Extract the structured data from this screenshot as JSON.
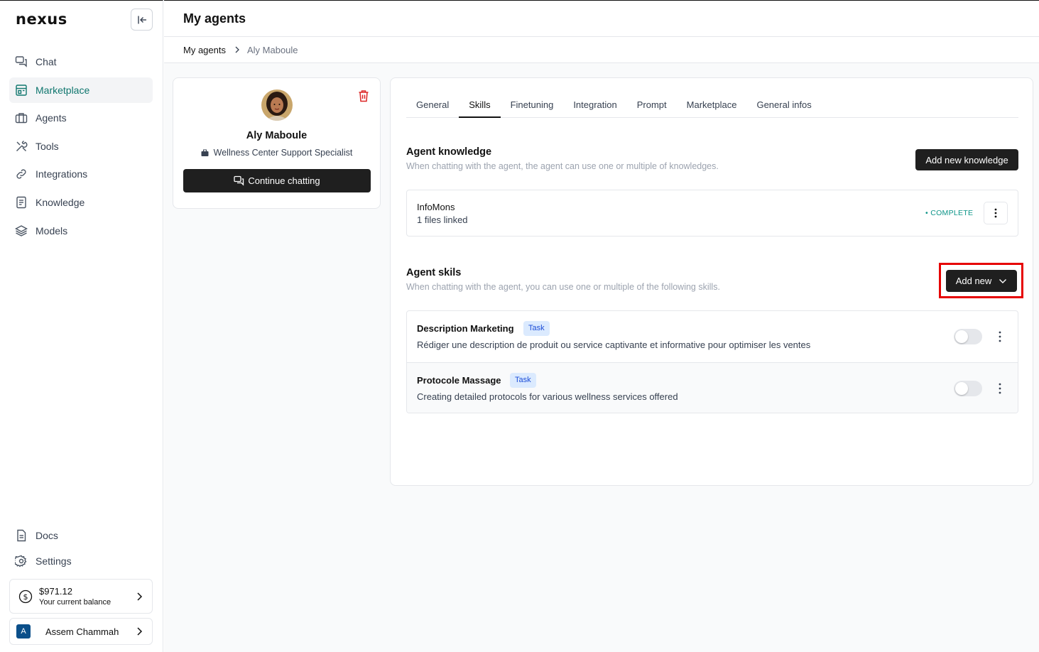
{
  "app": {
    "logo": "nexus"
  },
  "sidebar": {
    "items": [
      {
        "label": "Chat",
        "icon": "chat-icon",
        "active": false
      },
      {
        "label": "Marketplace",
        "icon": "store-icon",
        "active": true
      },
      {
        "label": "Agents",
        "icon": "briefcase-icon",
        "active": false
      },
      {
        "label": "Tools",
        "icon": "tools-icon",
        "active": false
      },
      {
        "label": "Integrations",
        "icon": "link-icon",
        "active": false
      },
      {
        "label": "Knowledge",
        "icon": "document-icon",
        "active": false
      },
      {
        "label": "Models",
        "icon": "layers-icon",
        "active": false
      }
    ],
    "bottom_items": [
      {
        "label": "Docs",
        "icon": "docs-icon"
      },
      {
        "label": "Settings",
        "icon": "gear-icon"
      }
    ],
    "balance": {
      "amount": "$971.12",
      "caption": "Your current balance"
    },
    "user": {
      "initial": "A",
      "name": "Assem Chammah"
    }
  },
  "header": {
    "title": "My agents"
  },
  "breadcrumb": [
    "My agents",
    "Aly Maboule"
  ],
  "profile": {
    "name": "Aly Maboule",
    "role": "Wellness Center Support Specialist",
    "continue_label": "Continue chatting"
  },
  "tabs": [
    {
      "label": "General",
      "active": false
    },
    {
      "label": "Skills",
      "active": true
    },
    {
      "label": "Finetuning",
      "active": false
    },
    {
      "label": "Integration",
      "active": false
    },
    {
      "label": "Prompt",
      "active": false
    },
    {
      "label": "Marketplace",
      "active": false
    },
    {
      "label": "General infos",
      "active": false
    }
  ],
  "knowledge": {
    "title": "Agent knowledge",
    "description": "When chatting with the agent, the agent can use one or multiple of knowledges.",
    "add_label": "Add new knowledge",
    "items": [
      {
        "name": "InfoMons",
        "files": "1 files linked",
        "status": "• COMPLETE"
      }
    ]
  },
  "skills": {
    "title": "Agent skils",
    "description": "When chatting with the agent, you can use one or multiple of the following skills.",
    "add_label": "Add new",
    "items": [
      {
        "name": "Description Marketing",
        "badge": "Task",
        "description": "Rédiger une description de produit ou service captivante et informative pour optimiser les ventes",
        "enabled": false
      },
      {
        "name": "Protocole Massage",
        "badge": "Task",
        "description": "Creating detailed protocols for various wellness services offered",
        "enabled": false
      }
    ]
  },
  "colors": {
    "accent": "#0f766e",
    "primary_button": "#1f1f1f",
    "danger": "#dc2626",
    "status_complete": "#0d9488",
    "highlight": "#e60000"
  }
}
